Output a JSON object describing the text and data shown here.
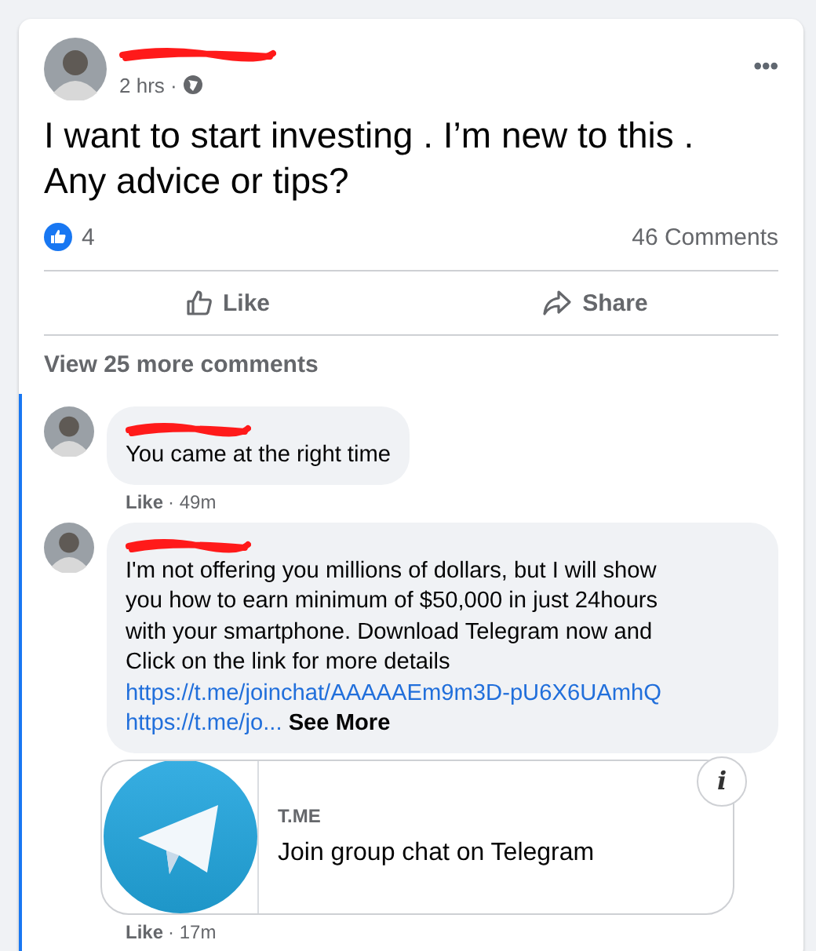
{
  "post": {
    "author": {
      "name_redacted": true
    },
    "time": "2 hrs ·",
    "more": "•••",
    "text": "I want to start investing . I’m new to this . Any advice or tips?",
    "reaction_count": "4",
    "comments_count": "46 Comments",
    "actions": [
      {
        "kind": "like",
        "label": "Like"
      },
      {
        "kind": "share",
        "label": "Share"
      }
    ]
  },
  "view_more": "View 25 more comments",
  "comments": [
    {
      "name_redacted": true,
      "text": "You came at the right time",
      "like": "Like",
      "time": "· 49m"
    },
    {
      "name_redacted": true,
      "text": "I'm not offering you millions of dollars, but I will show you how to earn minimum of $50,000 in just 24hours with your smartphone. Download Telegram now and Click on the link for more details",
      "links": [
        "https://t.me/joinchat/AAAAAEm9m3D-pU6X6UAmhQ",
        "https://t.me/jo..."
      ],
      "see_more": "See More",
      "preview": {
        "domain": "T.ME",
        "title": "Join group chat on Telegram",
        "info": "i"
      },
      "like": "Like",
      "time": "· 17m"
    }
  ]
}
